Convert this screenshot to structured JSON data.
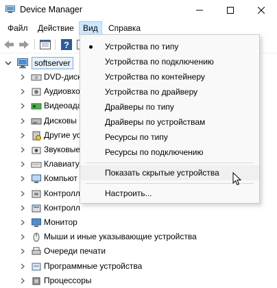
{
  "window": {
    "title": "Device Manager"
  },
  "menubar": {
    "items": [
      "Файл",
      "Действие",
      "Вид",
      "Справка"
    ],
    "active": "Вид"
  },
  "tree": {
    "root": "softserver",
    "items": [
      {
        "label": "DVD-диск",
        "icon": "dvd-drive-icon"
      },
      {
        "label": "Аудиовхо",
        "icon": "audio-icon"
      },
      {
        "label": "Видеоада",
        "icon": "display-adapter-icon"
      },
      {
        "label": "Дисковы",
        "icon": "disk-drive-icon"
      },
      {
        "label": "Другие ус",
        "icon": "other-devices-icon"
      },
      {
        "label": "Звуковые",
        "icon": "sound-icon"
      },
      {
        "label": "Клавиату",
        "icon": "keyboard-icon"
      },
      {
        "label": "Компьют",
        "icon": "computer-icon"
      },
      {
        "label": "Контролл",
        "icon": "controller-icon"
      },
      {
        "label": "Контролл",
        "icon": "storage-controller-icon"
      },
      {
        "label": "Монитор",
        "icon": "monitor-icon"
      },
      {
        "label": "Мыши и иные указывающие устройства",
        "icon": "mouse-icon"
      },
      {
        "label": "Очереди печати",
        "icon": "print-queue-icon"
      },
      {
        "label": "Программные устройства",
        "icon": "software-device-icon"
      },
      {
        "label": "Процессоры",
        "icon": "processor-icon"
      }
    ]
  },
  "view_menu": {
    "items": [
      {
        "label": "Устройства по типу",
        "checked": true
      },
      {
        "label": "Устройства по подключению"
      },
      {
        "label": "Устройства по контейнеру"
      },
      {
        "label": "Устройства по драйверу"
      },
      {
        "label": "Драйверы по типу"
      },
      {
        "label": "Драйверы по устройствам"
      },
      {
        "label": "Ресурсы по типу"
      },
      {
        "label": "Ресурсы по подключению"
      }
    ],
    "show_hidden": "Показать скрытые устройства",
    "customize": "Настроить..."
  }
}
